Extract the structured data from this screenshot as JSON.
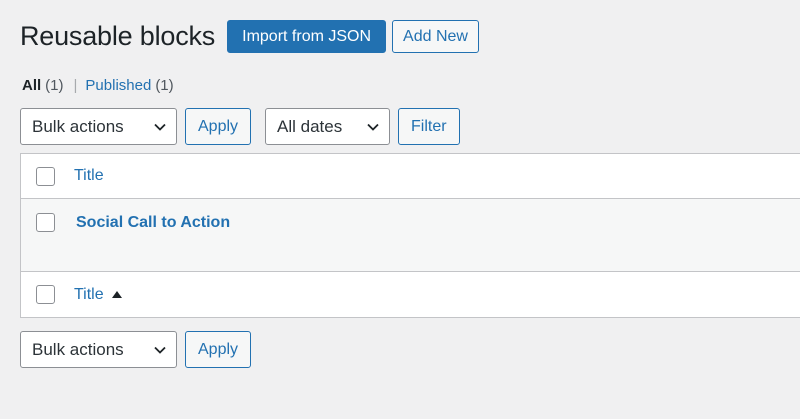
{
  "header": {
    "title": "Reusable blocks",
    "import_label": "Import from JSON",
    "add_new_label": "Add New"
  },
  "views": {
    "all_label": "All",
    "all_count": "(1)",
    "separator": "|",
    "published_label": "Published",
    "published_count": "(1)"
  },
  "tablenav_top": {
    "bulk_actions": "Bulk actions",
    "apply_label": "Apply",
    "dates_filter": "All dates",
    "filter_label": "Filter"
  },
  "table": {
    "header_title": "Title",
    "rows": [
      {
        "title": "Social Call to Action"
      }
    ],
    "footer_title": "Title"
  },
  "tablenav_bottom": {
    "bulk_actions": "Bulk actions",
    "apply_label": "Apply"
  },
  "colors": {
    "accent": "#2271b1",
    "background": "#f0f0f1",
    "text": "#1d2327"
  },
  "icons": {
    "select_arrow": "chevron-down-icon",
    "sort": "sort-ascending-icon"
  }
}
